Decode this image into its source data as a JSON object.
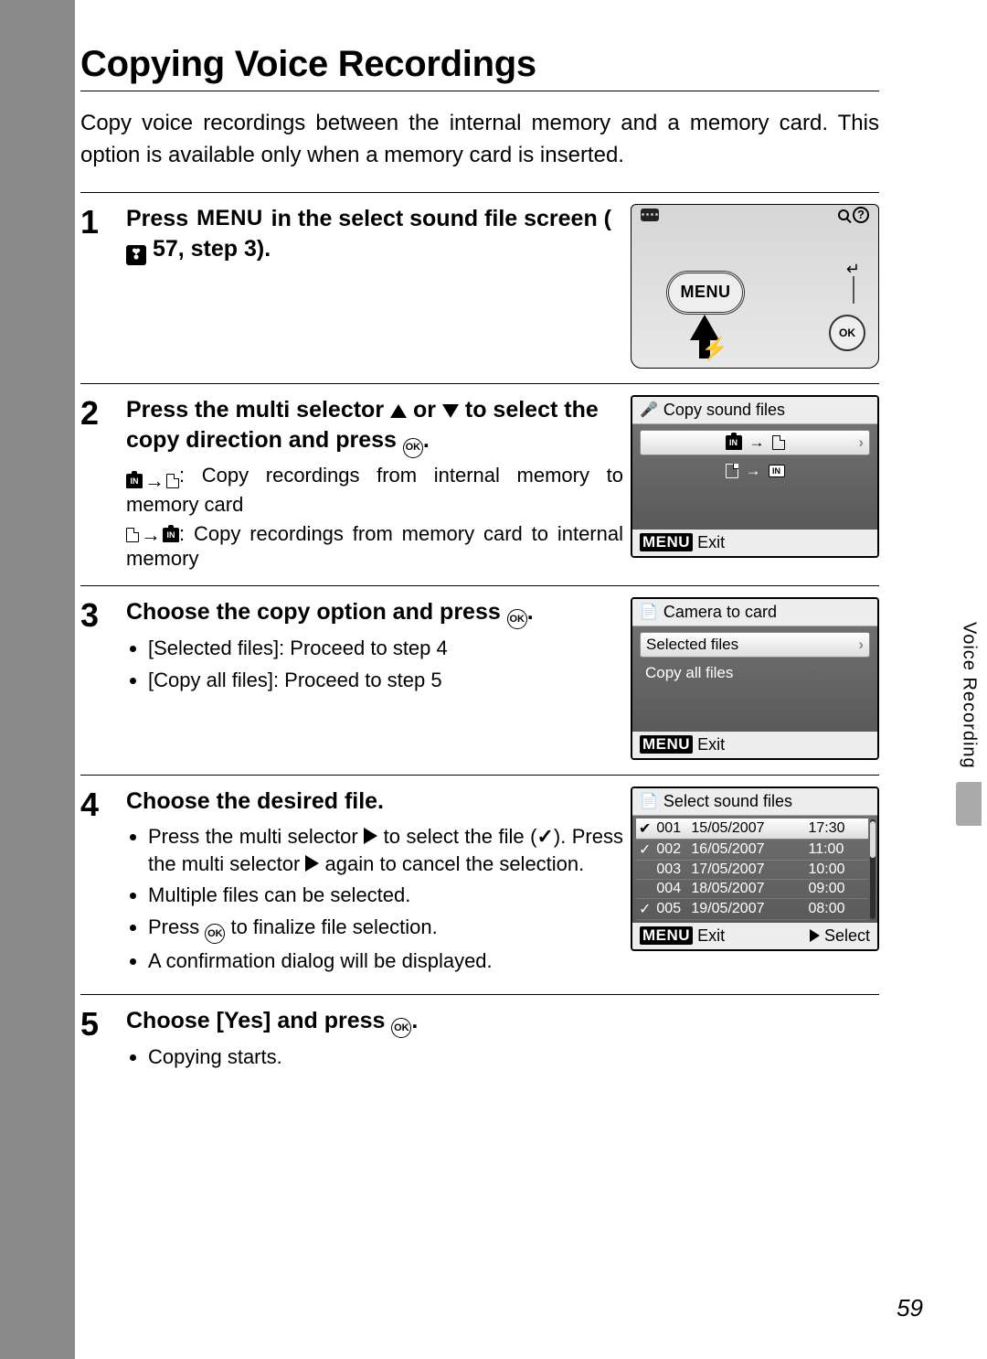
{
  "title": "Copying Voice Recordings",
  "intro": "Copy voice recordings between the internal memory and a memory card. This option is available only when a memory card is inserted.",
  "side_tab": "Voice Recording",
  "page_number": "59",
  "menu_word": "MENU",
  "ok_word": "OK",
  "steps": {
    "s1": {
      "num": "1",
      "head_pre": "Press ",
      "head_post": " in the select sound file screen (",
      "head_ref": " 57, step 3).",
      "menu_btn": "MENU",
      "ok_btn": "OK"
    },
    "s2": {
      "num": "2",
      "head_a": "Press the multi selector ",
      "head_b": " or ",
      "head_c": " to select the copy direction and press ",
      "head_d": ".",
      "sub1": ": Copy recordings from internal memory to memory card",
      "sub2": ": Copy recordings from memory card to internal memory",
      "lcd_title": "Copy sound files",
      "lcd_exit": "Exit"
    },
    "s3": {
      "num": "3",
      "head_a": "Choose the copy option and press ",
      "head_b": ".",
      "b1": "[Selected files]: Proceed to step 4",
      "b2": "[Copy all files]: Proceed to step 5",
      "lcd_title": "Camera to card",
      "opt1": "Selected files",
      "opt2": "Copy all files",
      "lcd_exit": "Exit"
    },
    "s4": {
      "num": "4",
      "head": "Choose the desired file.",
      "b1a": "Press the multi selector ",
      "b1b": " to select the file (",
      "b1c": "). Press the multi selector ",
      "b1d": " again to cancel the selection.",
      "b2": "Multiple files can be selected.",
      "b3a": "Press ",
      "b3b": " to finalize file selection.",
      "b4": "A confirmation dialog will be displayed.",
      "lcd_title": "Select sound files",
      "files": [
        {
          "ck": "✔",
          "n": "001",
          "d": "15/05/2007",
          "t": "17:30"
        },
        {
          "ck": "✓",
          "n": "002",
          "d": "16/05/2007",
          "t": "11:00"
        },
        {
          "ck": "",
          "n": "003",
          "d": "17/05/2007",
          "t": "10:00"
        },
        {
          "ck": "",
          "n": "004",
          "d": "18/05/2007",
          "t": "09:00"
        },
        {
          "ck": "✓",
          "n": "005",
          "d": "19/05/2007",
          "t": "08:00"
        }
      ],
      "lcd_exit": "Exit",
      "lcd_select": "Select"
    },
    "s5": {
      "num": "5",
      "head_a": "Choose [Yes] and press ",
      "head_b": ".",
      "b1": "Copying starts."
    }
  }
}
